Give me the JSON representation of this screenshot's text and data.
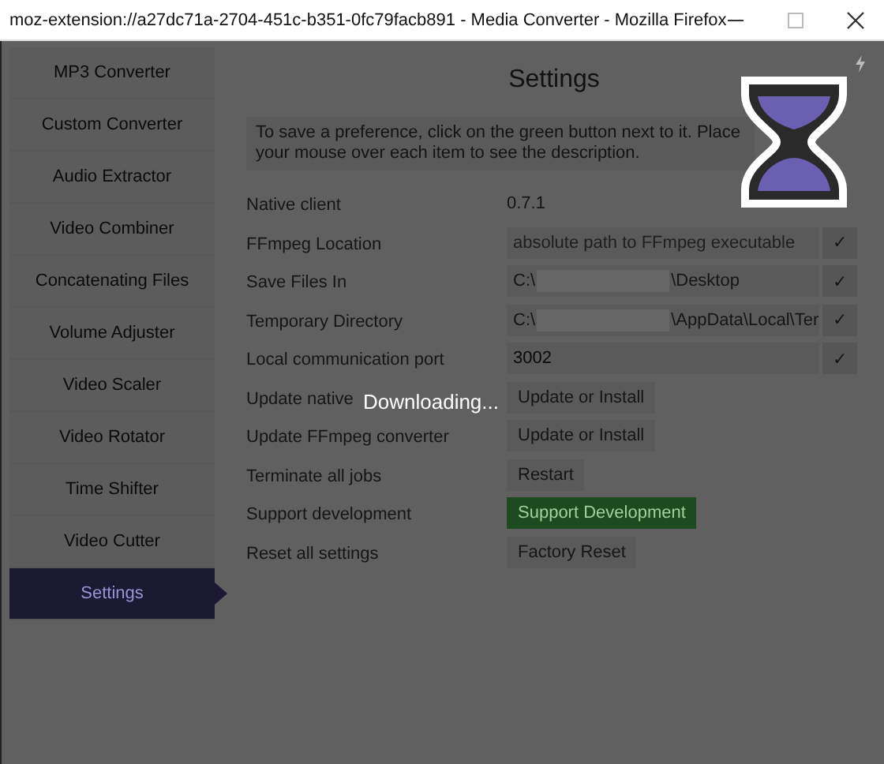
{
  "window": {
    "title": "moz-extension://a27dc71a-2704-451c-b351-0fc79facb891 - Media Converter - Mozilla Firefox"
  },
  "sidebar": {
    "items": [
      {
        "label": "MP3 Converter",
        "selected": false
      },
      {
        "label": "Custom Converter",
        "selected": false
      },
      {
        "label": "Audio Extractor",
        "selected": false
      },
      {
        "label": "Video Combiner",
        "selected": false
      },
      {
        "label": "Concatenating Files",
        "selected": false
      },
      {
        "label": "Volume Adjuster",
        "selected": false
      },
      {
        "label": "Video Scaler",
        "selected": false
      },
      {
        "label": "Video Rotator",
        "selected": false
      },
      {
        "label": "Time Shifter",
        "selected": false
      },
      {
        "label": "Video Cutter",
        "selected": false
      },
      {
        "label": "Settings",
        "selected": true
      }
    ]
  },
  "settings": {
    "title": "Settings",
    "notice": "To save a preference, click on the green button next to it. Place your mouse over each item to see the description.",
    "rows": [
      {
        "kind": "text",
        "label": "Native client",
        "value": "0.7.1"
      },
      {
        "kind": "input",
        "label": "FFmpeg Location",
        "placeholder": "absolute path to FFmpeg executable",
        "check": "✓"
      },
      {
        "kind": "path",
        "label": "Save Files In",
        "prefix": "C:\\",
        "suffix": "\\Desktop",
        "check": "✓"
      },
      {
        "kind": "path",
        "label": "Temporary Directory",
        "prefix": "C:\\",
        "suffix": "\\AppData\\Local\\Ter",
        "check": "✓"
      },
      {
        "kind": "input",
        "label": "Local communication port",
        "value": "3002",
        "check": "✓"
      },
      {
        "kind": "button",
        "label": "Update native",
        "button": "Update or Install"
      },
      {
        "kind": "button",
        "label": "Update FFmpeg converter",
        "button": "Update or Install"
      },
      {
        "kind": "button",
        "label": "Terminate all jobs",
        "button": "Restart"
      },
      {
        "kind": "donate",
        "label": "Support development",
        "button": "Support Development"
      },
      {
        "kind": "button",
        "label": "Reset all settings",
        "button": "Factory Reset"
      }
    ]
  },
  "overlay": {
    "message": "Downloading..."
  }
}
